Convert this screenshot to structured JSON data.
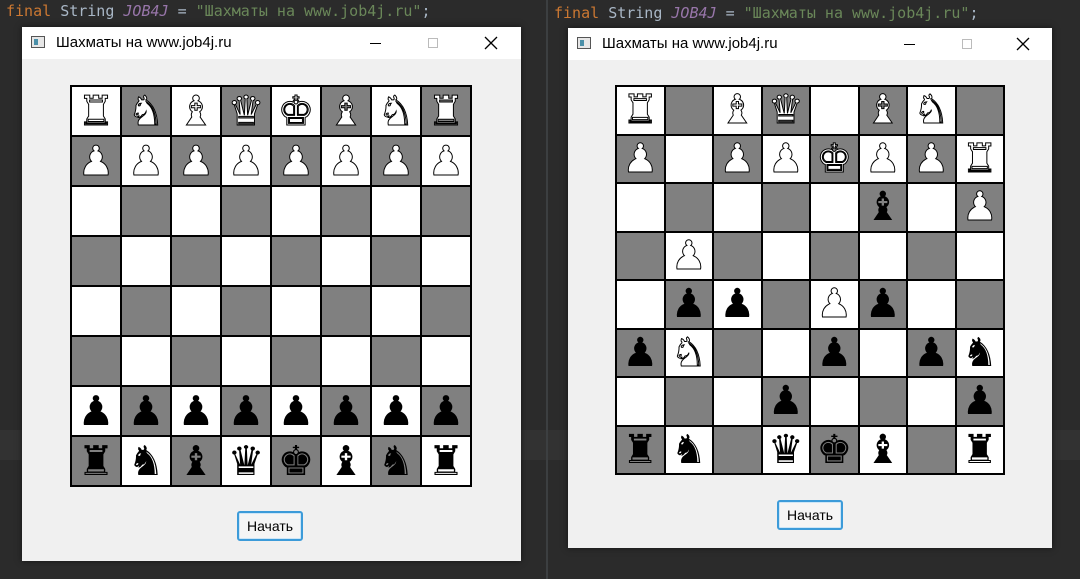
{
  "code": {
    "left_line": {
      "kw": "final",
      "type": "String",
      "const": "JOB4J",
      "eq": " = ",
      "str": "\"Шахматы на www.job4j.ru\"",
      "end": ";"
    },
    "right_line": {
      "kw": "final",
      "type": "String",
      "const": "JOB4J",
      "eq": " = ",
      "str": "\"Шахматы на www.job4j.ru\"",
      "end": ";"
    }
  },
  "windows": [
    {
      "title": "Шахматы на www.job4j.ru",
      "start_button": "Начать",
      "board": [
        [
          "wR",
          "wN",
          "wB",
          "wQ",
          "wK",
          "wB",
          "wN",
          "wR"
        ],
        [
          "wP",
          "wP",
          "wP",
          "wP",
          "wP",
          "wP",
          "wP",
          "wP"
        ],
        [
          "",
          "",
          "",
          "",
          "",
          "",
          "",
          ""
        ],
        [
          "",
          "",
          "",
          "",
          "",
          "",
          "",
          ""
        ],
        [
          "",
          "",
          "",
          "",
          "",
          "",
          "",
          ""
        ],
        [
          "",
          "",
          "",
          "",
          "",
          "",
          "",
          ""
        ],
        [
          "bP",
          "bP",
          "bP",
          "bP",
          "bP",
          "bP",
          "bP",
          "bP"
        ],
        [
          "bR",
          "bN",
          "bB",
          "bQ",
          "bK",
          "bB",
          "bN",
          "bR"
        ]
      ]
    },
    {
      "title": "Шахматы на www.job4j.ru",
      "start_button": "Начать",
      "board": [
        [
          "wR",
          "",
          "wB",
          "wQ",
          "",
          "wB",
          "wN",
          ""
        ],
        [
          "wP",
          "",
          "wP",
          "wP",
          "wK",
          "wP",
          "wP",
          "wR"
        ],
        [
          "",
          "",
          "",
          "",
          "",
          "bB",
          "",
          "wP"
        ],
        [
          "",
          "wP",
          "",
          "",
          "",
          "",
          "",
          ""
        ],
        [
          "",
          "bP",
          "bP",
          "",
          "wP",
          "bP",
          "",
          ""
        ],
        [
          "bP",
          "wN",
          "",
          "",
          "bP",
          "",
          "bP",
          "bN"
        ],
        [
          "",
          "",
          "",
          "bP",
          "",
          "",
          "",
          "bP"
        ],
        [
          "bR",
          "bN",
          "",
          "bQ",
          "bK",
          "bB",
          "",
          "bR"
        ]
      ]
    }
  ],
  "colors": {
    "light_square": "#ffffff",
    "dark_square": "#808080",
    "button_border": "#3c9bd9",
    "ide_background": "#2b2b2b"
  },
  "icons": {
    "minimize": "minimize-icon",
    "maximize": "maximize-icon",
    "close": "close-icon",
    "app": "app-icon"
  }
}
